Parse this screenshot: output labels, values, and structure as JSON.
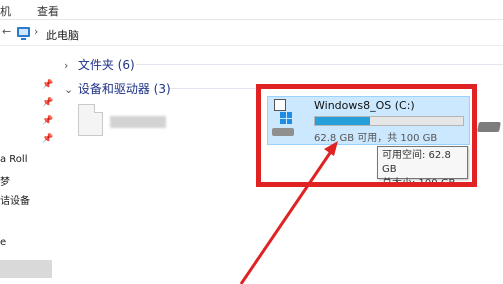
{
  "menu": {
    "left_partial": "机",
    "view": "查看"
  },
  "address": {
    "back_arrow": "←",
    "sep": "›",
    "crumb": "此电脑"
  },
  "nav": {
    "items": [
      {
        "label": "a Roll"
      },
      {
        "label": "梦"
      },
      {
        "label": "诘设备"
      },
      {
        "label": "e"
      }
    ],
    "pin_glyph": "📌"
  },
  "groups": {
    "folders": {
      "chevron": "›",
      "label": "文件夹 (6)"
    },
    "devices": {
      "chevron": "⌄",
      "label": "设备和驱动器 (3)"
    }
  },
  "drive": {
    "name": "Windows8_OS (C:)",
    "space_text": "62.8 GB 可用，共 100 GB",
    "used_fraction": 0.372,
    "icon": "windows-drive-icon"
  },
  "tooltip": {
    "free": "可用空间: 62.8 GB",
    "total": "总大小: 100 GB"
  },
  "colors": {
    "accent": "#26a0da",
    "selection": "#cce8ff",
    "annotation": "#e12222"
  }
}
